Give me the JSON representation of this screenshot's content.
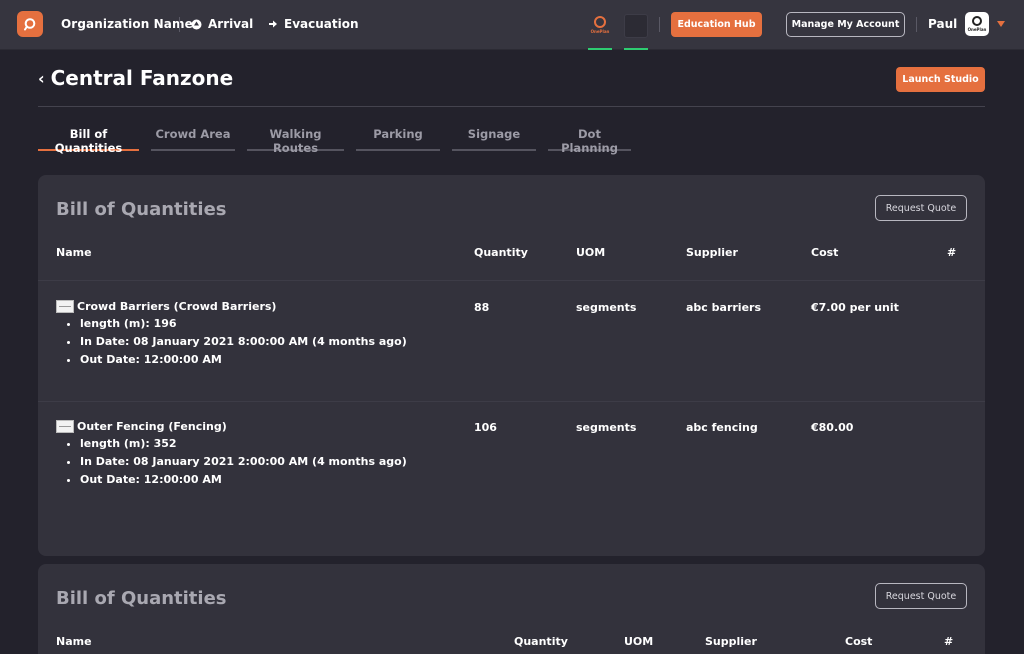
{
  "topbar": {
    "org_name": "Organization Name",
    "nav": [
      {
        "label": "Arrival",
        "icon": "arrival-icon"
      },
      {
        "label": "Evacuation",
        "icon": "arrow-right-icon"
      }
    ],
    "mini_logo_text": "OnePlan",
    "education_hub": "Education Hub",
    "manage_account": "Manage My Account",
    "user_name": "Paul",
    "avatar_text": "OnePlan"
  },
  "page": {
    "title": "Central Fanzone",
    "launch_studio": "Launch Studio"
  },
  "tabs": [
    {
      "label": "Bill of Quantities",
      "active": true
    },
    {
      "label": "Crowd Area",
      "active": false
    },
    {
      "label": "Walking Routes",
      "active": false
    },
    {
      "label": "Parking",
      "active": false
    },
    {
      "label": "Signage",
      "active": false
    },
    {
      "label": "Dot Planning",
      "active": false
    }
  ],
  "cards": [
    {
      "title": "Bill of Quantities",
      "request_quote": "Request Quote",
      "columns": [
        "Name",
        "Quantity",
        "UOM",
        "Supplier",
        "Cost",
        "#"
      ],
      "rows": [
        {
          "name": "Crowd Barriers (Crowd Barriers)",
          "details": [
            "length (m): 196",
            "In Date: 08 January 2021 8:00:00 AM (4 months ago)",
            "Out Date: 12:00:00 AM"
          ],
          "quantity": "88",
          "uom": "segments",
          "supplier": "abc barriers",
          "cost": "€7.00 per unit"
        },
        {
          "name": "Outer Fencing (Fencing)",
          "details": [
            "length (m): 352",
            "In Date: 08 January 2021 2:00:00 AM (4 months ago)",
            "Out Date: 12:00:00 AM"
          ],
          "quantity": "106",
          "uom": "segments",
          "supplier": "abc fencing",
          "cost": "€80.00"
        }
      ]
    },
    {
      "title": "Bill of Quantities",
      "request_quote": "Request Quote",
      "columns": [
        "Name",
        "Quantity",
        "UOM",
        "Supplier",
        "Cost",
        "#"
      ]
    }
  ],
  "colors": {
    "accent": "#e5703f",
    "background": "#23222c",
    "topbar": "#36353f",
    "card": "#33323c",
    "indicator": "#2ecc71"
  }
}
